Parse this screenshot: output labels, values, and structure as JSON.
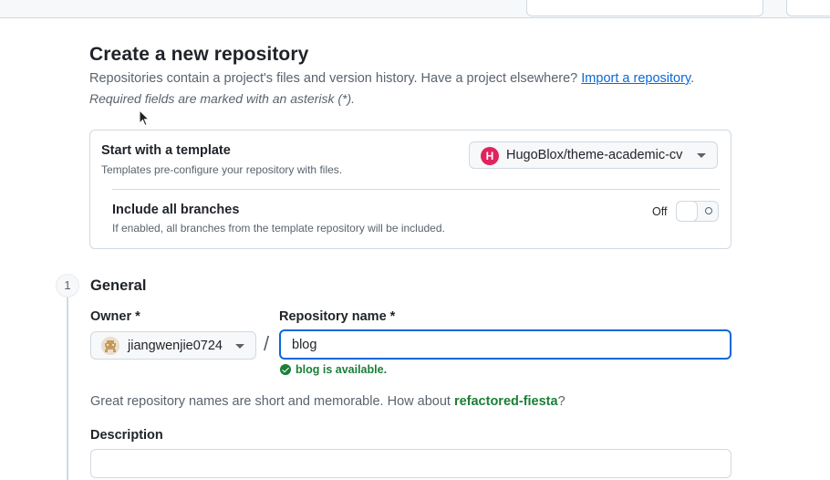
{
  "page": {
    "title": "Create a new repository",
    "intro": "Repositories contain a project's files and version history. Have a project elsewhere?",
    "import_link": "Import a repository",
    "intro_end": ".",
    "required_note": "Required fields are marked with an asterisk (*)."
  },
  "template": {
    "title": "Start with a template",
    "subtitle": "Templates pre-configure your repository with files.",
    "selected": "HugoBlox/theme-academic-cv",
    "logo_letter": "H",
    "brand_color": "#e0245e"
  },
  "include_branches": {
    "title": "Include all branches",
    "subtitle": "If enabled, all branches from the template repository will be included.",
    "state_label": "Off"
  },
  "general": {
    "step": "1",
    "title": "General",
    "owner_label": "Owner *",
    "owner_value": "jiangwenjie0724",
    "separator": "/",
    "repo_label": "Repository name *",
    "repo_value": "blog",
    "available": "blog is available.",
    "hint_prefix": "Great repository names are short and memorable. How about",
    "hint_suggestion": "refactored-fiesta",
    "hint_suffix": "?",
    "description_label": "Description",
    "description_value": ""
  },
  "colors": {
    "accent": "#0969da",
    "success": "#1a7f37"
  }
}
